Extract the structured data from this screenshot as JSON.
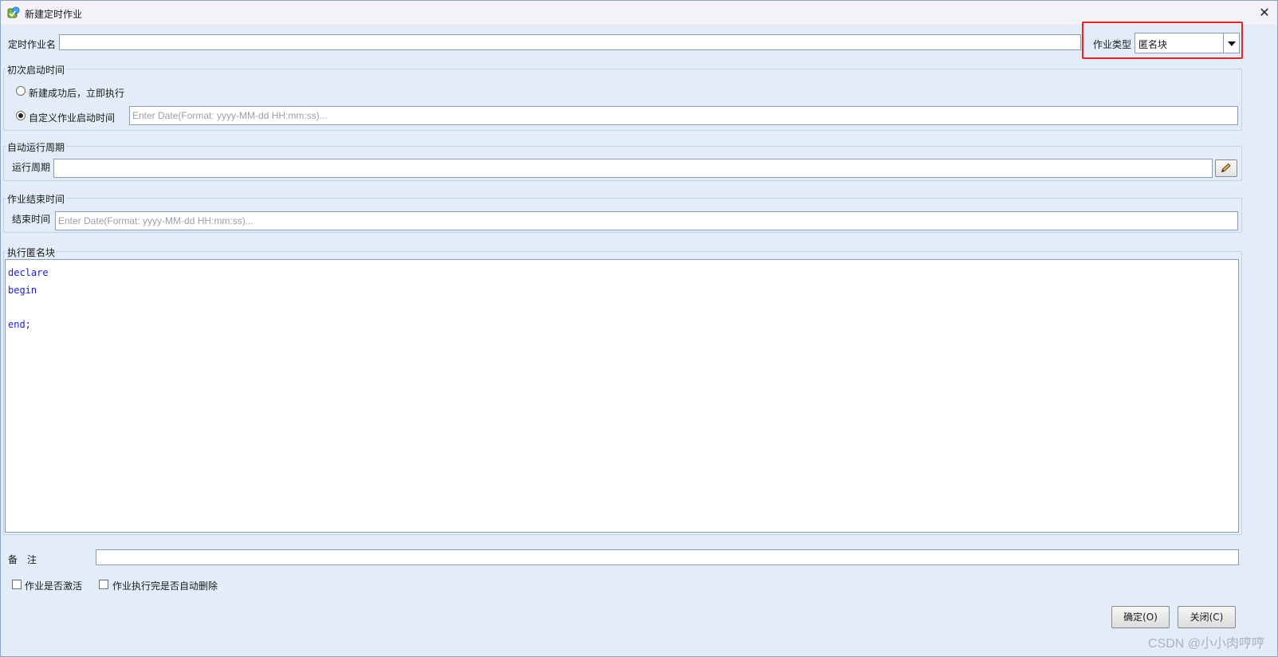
{
  "window": {
    "title": "新建定时作业",
    "close_glyph": "✕"
  },
  "job_name": {
    "label": "定时作业名",
    "value": ""
  },
  "job_type": {
    "label": "作业类型",
    "selected": "匿名块",
    "highlight_color": "#e8232a"
  },
  "first_start": {
    "group_title": "初次启动时间",
    "option_immediate": "新建成功后，立即执行",
    "option_custom": "自定义作业启动时间",
    "selected_option": "custom",
    "date_placeholder": "Enter Date(Format: yyyy-MM-dd HH:mm:ss)..."
  },
  "auto_run": {
    "group_title": "自动运行周期",
    "period_label": "运行周期",
    "period_value": "",
    "edit_icon": "pencil-icon"
  },
  "job_end": {
    "group_title": "作业结束时间",
    "end_label": "结束时间",
    "date_placeholder": "Enter Date(Format: yyyy-MM-dd HH:mm:ss)..."
  },
  "anon_block": {
    "group_title": "执行匿名块",
    "code_lines": [
      "declare",
      "begin",
      "",
      "end;"
    ],
    "keyword_color": "#1c1ccc"
  },
  "remark": {
    "label": "备　注",
    "value": ""
  },
  "options": {
    "activate_label": "作业是否激活",
    "activate_checked": false,
    "auto_delete_label": "作业执行完是否自动删除",
    "auto_delete_checked": false
  },
  "buttons": {
    "ok": "确定(O)",
    "close": "关闭(C)"
  },
  "watermark": "CSDN @小小肉哼哼"
}
